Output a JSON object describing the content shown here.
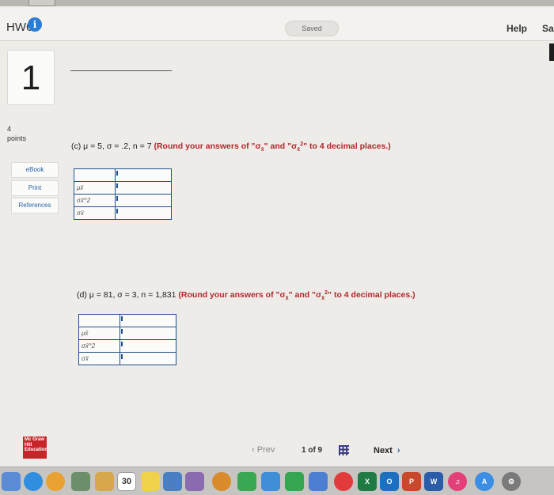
{
  "header": {
    "title": "HW6",
    "info_icon": "i",
    "saved_label": "Saved",
    "help_label": "Help",
    "save_label": "Sav"
  },
  "question": {
    "number": "1",
    "points_value": "4",
    "points_label": "points"
  },
  "sidebar": {
    "items": [
      {
        "label": "eBook"
      },
      {
        "label": "Print"
      },
      {
        "label": "References"
      }
    ]
  },
  "part_c": {
    "prefix": "(c) μ = 5, σ = .2, n = 7",
    "instruction_start": "(Round your answers of \"σ",
    "sub1": "x̄",
    "instruction_mid": "\" and \"σ",
    "sub2": "x̄",
    "sup2": "2",
    "instruction_end": "\" to 4 decimal places.)",
    "rows": [
      {
        "label": "μx̄",
        "value": ""
      },
      {
        "label": "σx̄^2",
        "value": ""
      },
      {
        "label": "σx̄",
        "value": ""
      }
    ]
  },
  "part_d": {
    "prefix": "(d) μ = 81, σ = 3, n = 1,831",
    "instruction_start": "(Round your answers of \"σ",
    "sub1": "x̄",
    "instruction_mid": "\" and \"σ",
    "sub2": "x̄",
    "sup2": "2",
    "instruction_end": "\" to 4 decimal places.)",
    "rows": [
      {
        "label": "μx̄",
        "value": ""
      },
      {
        "label": "σx̄^2",
        "value": ""
      },
      {
        "label": "σx̄",
        "value": ""
      }
    ]
  },
  "footer": {
    "logo_text": "Mc Graw Hill Education",
    "prev_label": "Prev",
    "page_indicator": "1 of 9",
    "next_label": "Next"
  },
  "dock": {
    "calendar_day": "30",
    "icons": [
      "finder-icon",
      "safari-icon",
      "chrome-icon",
      "photos-icon",
      "notes-icon",
      "calendar-icon",
      "stickies-icon",
      "preview-icon",
      "photo-booth-icon",
      "messages-icon",
      "facetime-icon",
      "keynote-icon",
      "numbers-icon",
      "keynote-podium-icon",
      "news-icon",
      "excel-icon",
      "outlook-icon",
      "powerpoint-icon",
      "word-icon",
      "itunes-icon",
      "app-store-icon",
      "system-preferences-icon"
    ]
  },
  "colors": {
    "accent_blue": "#2b7cd3",
    "question_red": "#b3262b",
    "table_border": "#1f4f8c"
  }
}
